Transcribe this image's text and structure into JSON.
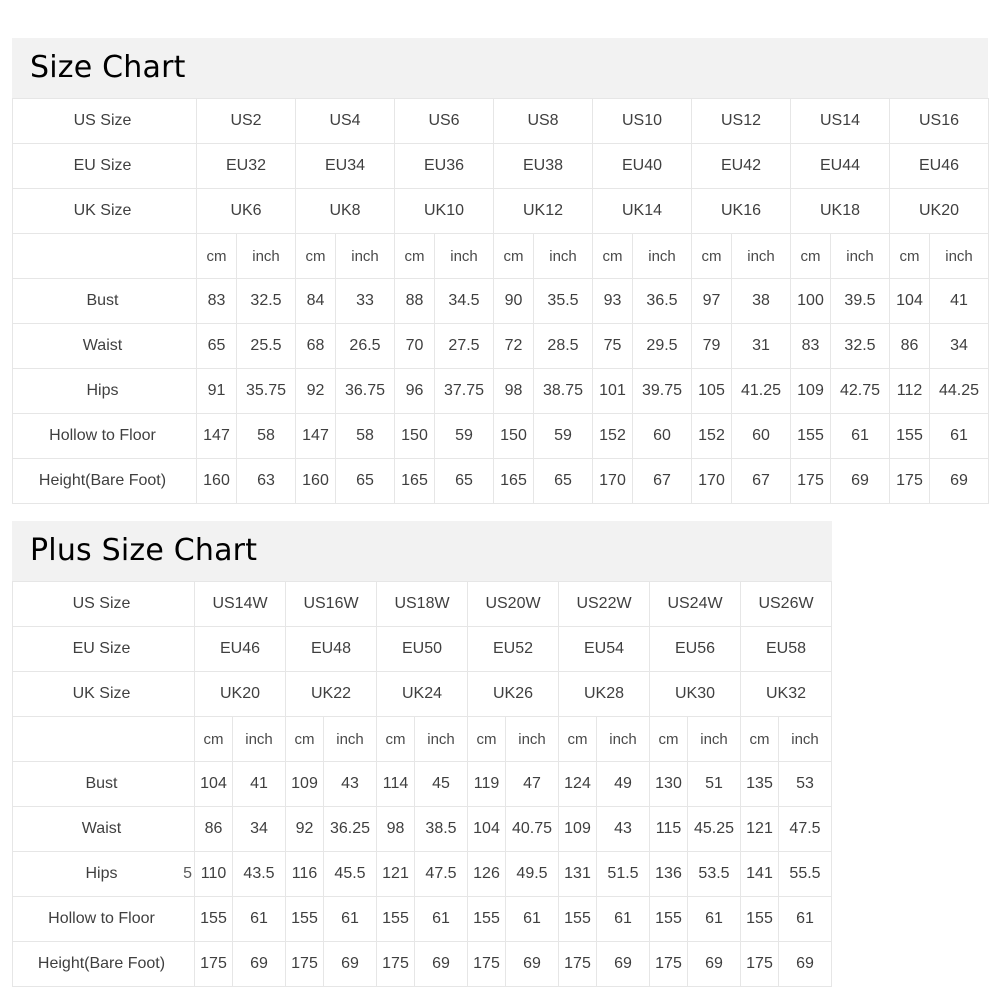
{
  "page": {
    "background": "#ffffff",
    "grid_color": "#e6e6e6",
    "title_bar_color": "#f2f2f2",
    "text_color": "#3f3f3f"
  },
  "charts": [
    {
      "id": "standard",
      "title": "Size Chart",
      "row_labels": {
        "us": "US Size",
        "eu": "EU Size",
        "uk": "UK Size",
        "units": "",
        "bust": "Bust",
        "waist": "Waist",
        "hips": "Hips",
        "hollow": "Hollow to Floor",
        "height": "Height(Bare Foot)"
      },
      "unit_labels": {
        "cm": "cm",
        "inch": "inch"
      },
      "us_sizes": [
        "US2",
        "US4",
        "US6",
        "US8",
        "US10",
        "US12",
        "US14",
        "US16"
      ],
      "eu_sizes": [
        "EU32",
        "EU34",
        "EU36",
        "EU38",
        "EU40",
        "EU42",
        "EU44",
        "EU46"
      ],
      "uk_sizes": [
        "UK6",
        "UK8",
        "UK10",
        "UK12",
        "UK14",
        "UK16",
        "UK18",
        "UK20"
      ],
      "measurements": [
        {
          "name": "Bust",
          "cm": [
            "83",
            "84",
            "88",
            "90",
            "93",
            "97",
            "100",
            "104"
          ],
          "inch": [
            "32.5",
            "33",
            "34.5",
            "35.5",
            "36.5",
            "38",
            "39.5",
            "41"
          ]
        },
        {
          "name": "Waist",
          "cm": [
            "65",
            "68",
            "70",
            "72",
            "75",
            "79",
            "83",
            "86"
          ],
          "inch": [
            "25.5",
            "26.5",
            "27.5",
            "28.5",
            "29.5",
            "31",
            "32.5",
            "34"
          ]
        },
        {
          "name": "Hips",
          "cm": [
            "91",
            "92",
            "96",
            "98",
            "101",
            "105",
            "109",
            "112"
          ],
          "inch": [
            "35.75",
            "36.75",
            "37.75",
            "38.75",
            "39.75",
            "41.25",
            "42.75",
            "44.25"
          ]
        },
        {
          "name": "Hollow to Floor",
          "cm": [
            "147",
            "147",
            "150",
            "150",
            "152",
            "152",
            "155",
            "155"
          ],
          "inch": [
            "58",
            "58",
            "59",
            "59",
            "60",
            "60",
            "61",
            "61"
          ]
        },
        {
          "name": "Height(Bare Foot)",
          "cm": [
            "160",
            "160",
            "165",
            "165",
            "170",
            "170",
            "175",
            "175"
          ],
          "inch": [
            "63",
            "65",
            "65",
            "65",
            "67",
            "67",
            "69",
            "69"
          ]
        }
      ]
    },
    {
      "id": "plus",
      "title": "Plus Size Chart",
      "row_labels": {
        "us": "US Size",
        "eu": "EU Size",
        "uk": "UK Size",
        "units": "",
        "bust": "Bust",
        "waist": "Waist",
        "hips": "Hips",
        "hollow": "Hollow to Floor",
        "height": "Height(Bare Foot)"
      },
      "unit_labels": {
        "cm": "cm",
        "inch": "inch"
      },
      "us_sizes": [
        "US14W",
        "US16W",
        "US18W",
        "US20W",
        "US22W",
        "US24W",
        "US26W"
      ],
      "eu_sizes": [
        "EU46",
        "EU48",
        "EU50",
        "EU52",
        "EU54",
        "EU56",
        "EU58"
      ],
      "uk_sizes": [
        "UK20",
        "UK22",
        "UK24",
        "UK26",
        "UK28",
        "UK30",
        "UK32"
      ],
      "hips_label_overflow": "5",
      "measurements": [
        {
          "name": "Bust",
          "cm": [
            "104",
            "109",
            "114",
            "119",
            "124",
            "130",
            "135"
          ],
          "inch": [
            "41",
            "43",
            "45",
            "47",
            "49",
            "51",
            "53"
          ]
        },
        {
          "name": "Waist",
          "cm": [
            "86",
            "92",
            "98",
            "104",
            "109",
            "115",
            "121"
          ],
          "inch": [
            "34",
            "36.25",
            "38.5",
            "40.75",
            "43",
            "45.25",
            "47.5"
          ]
        },
        {
          "name": "Hips",
          "cm": [
            "110",
            "116",
            "121",
            "126",
            "131",
            "136",
            "141"
          ],
          "inch": [
            "43.5",
            "45.5",
            "47.5",
            "49.5",
            "51.5",
            "53.5",
            "55.5"
          ]
        },
        {
          "name": "Hollow to Floor",
          "cm": [
            "155",
            "155",
            "155",
            "155",
            "155",
            "155",
            "155"
          ],
          "inch": [
            "61",
            "61",
            "61",
            "61",
            "61",
            "61",
            "61"
          ]
        },
        {
          "name": "Height(Bare Foot)",
          "cm": [
            "175",
            "175",
            "175",
            "175",
            "175",
            "175",
            "175"
          ],
          "inch": [
            "69",
            "69",
            "69",
            "69",
            "69",
            "69",
            "69"
          ]
        }
      ]
    }
  ]
}
